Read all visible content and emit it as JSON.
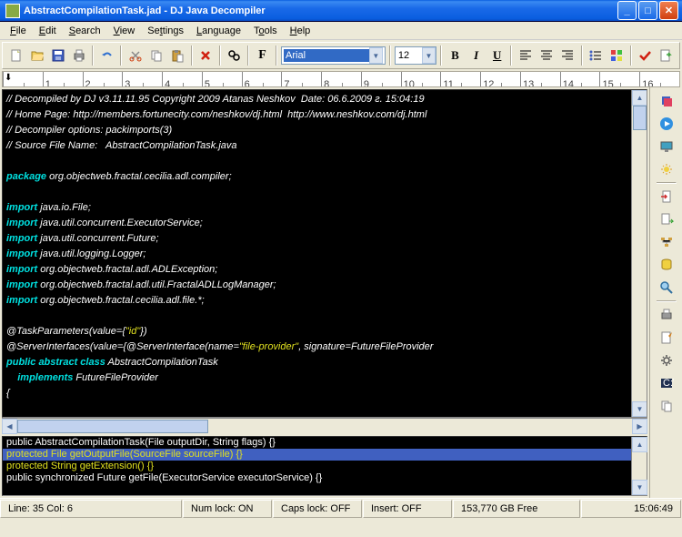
{
  "title": "AbstractCompilationTask.jad - DJ Java Decompiler",
  "menu": [
    "File",
    "Edit",
    "Search",
    "View",
    "Settings",
    "Language",
    "Tools",
    "Help"
  ],
  "font": {
    "name": "Arial",
    "size": "12"
  },
  "code": {
    "c1": "// Decompiled by DJ v3.11.11.95 Copyright 2009 Atanas Neshkov  Date: 06.6.2009 г. 15:04:19",
    "c2": "// Home Page: http://members.fortunecity.com/neshkov/dj.html  http://www.neshkov.com/dj.html",
    "c3": "// Decompiler options: packimports(3) ",
    "c4": "// Source File Name:   AbstractCompilationTask.java",
    "pkg_kw": "package",
    "pkg": " org.objectweb.fractal.cecilia.adl.compiler;",
    "imp": "import",
    "i1": " java.io.File;",
    "i2": " java.util.concurrent.ExecutorService;",
    "i3": " java.util.concurrent.Future;",
    "i4": " java.util.logging.Logger;",
    "i5": " org.objectweb.fractal.adl.ADLException;",
    "i6": " org.objectweb.fractal.adl.util.FractalADLLogManager;",
    "i7": " org.objectweb.fractal.cecilia.adl.file.*;",
    "a1a": "@TaskParameters(value={",
    "a1s": "\"id\"",
    "a1b": "})",
    "a2a": "@ServerInterfaces(value={@ServerInterface(name=",
    "a2s": "\"file-provider\"",
    "a2b": ", signature=FutureFileProvider",
    "cls1": "public abstract class",
    "cls2": " AbstractCompilationTask",
    "cls3": "implements",
    "cls4": " FutureFileProvider",
    "brace": "{"
  },
  "methods": [
    "public AbstractCompilationTask(File outputDir, String flags) {}",
    "protected File getOutputFile(SourceFile sourceFile) {}",
    "protected String getExtension() {}",
    "public synchronized Future getFile(ExecutorService executorService) {}"
  ],
  "status": {
    "pos": "Line:  35   Col:   6",
    "num": "Num lock: ON",
    "caps": "Caps lock: OFF",
    "ins": "Insert: OFF",
    "disk": "153,770 GB Free",
    "time": "15:06:49"
  }
}
